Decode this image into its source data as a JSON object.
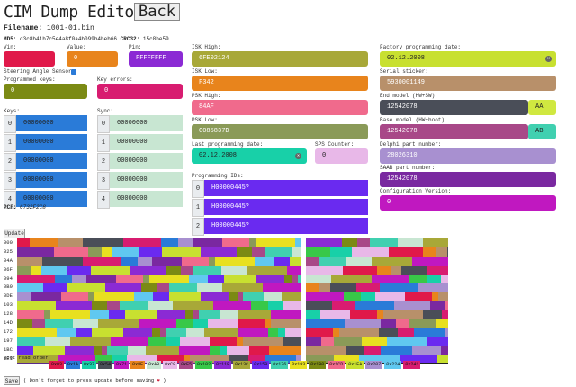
{
  "header": {
    "title": "CIM Dump Editor",
    "back": "Back",
    "filename_label": "Filename:",
    "filename": "1001-01.bin",
    "md5_label": "MD5:",
    "md5": "d3c8b41b7c5e4a8f0a4b099b4beb66",
    "crc_label": "CRC32:",
    "crc": "15c8be59"
  },
  "vin": {
    "label": "Vin:",
    "value": ""
  },
  "value_field": {
    "label": "Value:",
    "value": "0"
  },
  "pin": {
    "label": "Pin:",
    "value": "FFFFFFFF"
  },
  "steering": {
    "label": "Steering Angle Sensor:",
    "checked": true
  },
  "programmed_keys": {
    "label": "Programmed keys:",
    "value": "0"
  },
  "key_errors": {
    "label": "Key errors:",
    "value": "0"
  },
  "keys": {
    "label": "Keys:",
    "items": [
      {
        "idx": "0",
        "val": "00000000"
      },
      {
        "idx": "1",
        "val": "00000000"
      },
      {
        "idx": "2",
        "val": "00000000"
      },
      {
        "idx": "3",
        "val": "00000000"
      },
      {
        "idx": "4",
        "val": "00000000"
      }
    ]
  },
  "sync": {
    "label": "Sync:",
    "items": [
      {
        "idx": "0",
        "val": "00000000"
      },
      {
        "idx": "1",
        "val": "00000000"
      },
      {
        "idx": "2",
        "val": "00000000"
      },
      {
        "idx": "3",
        "val": "00000000"
      },
      {
        "idx": "4",
        "val": "00000000"
      }
    ]
  },
  "pcf": {
    "label": "PCF:",
    "value": "6732F2C8"
  },
  "isk_high": {
    "label": "ISK High:",
    "value": "6FE02124"
  },
  "isk_low": {
    "label": "ISK Low:",
    "value": "F342"
  },
  "psk_high": {
    "label": "PSK High:",
    "value": "84AF"
  },
  "psk_low": {
    "label": "PSK Low:",
    "value": "C085837D"
  },
  "last_prog": {
    "label": "Last programming date:",
    "value": "02.12.2008"
  },
  "sps": {
    "label": "SPS Counter:",
    "value": "0"
  },
  "prog_ids": {
    "label": "Programming IDs:",
    "items": [
      {
        "idx": "0",
        "val": "H00000445?"
      },
      {
        "idx": "1",
        "val": "H00000445?"
      },
      {
        "idx": "2",
        "val": "H00000445?"
      }
    ]
  },
  "factory_date": {
    "label": "Factory programming date:",
    "value": "02.12.2008"
  },
  "serial": {
    "label": "Serial sticker:",
    "value": "5930001149"
  },
  "end_model": {
    "label": "End model (HW+SW)",
    "value": "12542078",
    "suffix": "AA"
  },
  "base_model": {
    "label": "Base model (HW+boot)",
    "value": "12542078",
    "suffix": "AB"
  },
  "delphi": {
    "label": "Delphi part number:",
    "value": "28026310"
  },
  "saab": {
    "label": "SAAB part number:",
    "value": "12542078"
  },
  "config": {
    "label": "Configuration Version:",
    "value": "0"
  },
  "update_label": "Update",
  "hex_offsets": [
    "000",
    "025",
    "04A",
    "06F",
    "094",
    "0B9",
    "0DE",
    "103",
    "128",
    "14D",
    "172",
    "197",
    "1BC",
    "1E1"
  ],
  "boot_label": "Boot read order",
  "boot_chips": [
    "0x03",
    "0x1A",
    "0x37",
    "0x54",
    "0x71",
    "0x8E",
    "0xAB",
    "0xC8",
    "0xE5",
    "0x102",
    "0x11F",
    "0x13C",
    "0x159",
    "0x176",
    "0x193",
    "0x1B0",
    "0x1CD",
    "0x1EA",
    "0x207",
    "0x224",
    "0x241"
  ],
  "save_label": "Save",
  "save_note": "( Don't forget to press update before saving",
  "save_heart": "❤",
  "save_close": ")",
  "colors": {
    "vin": "#e0194a",
    "value": "#e8841c",
    "pin": "#8b2ad4",
    "prog": "#7b8a14",
    "keyerr": "#d81c70",
    "keys": "#2a7bd8",
    "sync": "#c8e6d2",
    "isk_high": "#a8a838",
    "isk_low": "#e8841c",
    "psk_high": "#f06a8c",
    "psk_low": "#8a9a58",
    "lastprog": "#18d0a8",
    "sps": "#e8b8e8",
    "progids": "#6a2af0",
    "factory": "#c8e030",
    "serial": "#b8906a",
    "endmodel": "#4a4e58",
    "endsfx": "#d0e840",
    "basemodel": "#a84888",
    "basesfx": "#40d0b0",
    "delphi": "#a890d0",
    "saab": "#7a28a0",
    "config": "#c018c0"
  }
}
